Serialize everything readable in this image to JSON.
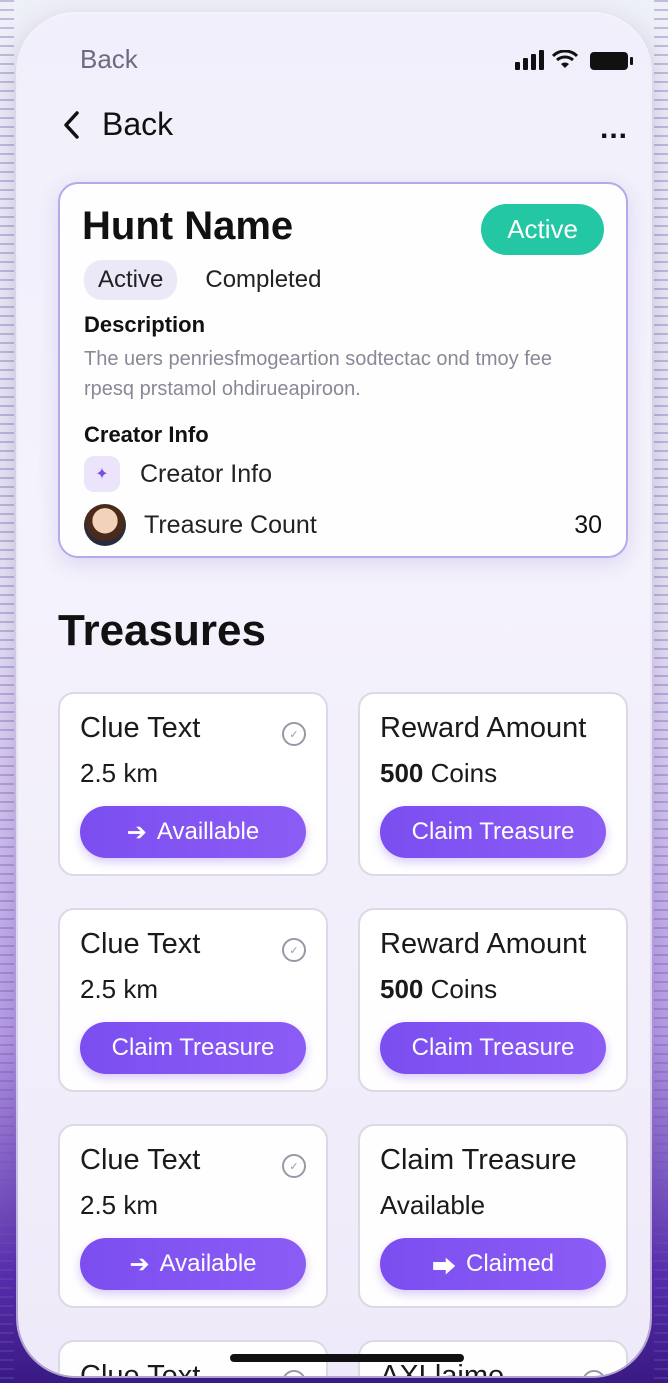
{
  "status_bar": {
    "back_label": "Back"
  },
  "nav": {
    "back_label": "Back",
    "more_label": "..."
  },
  "hunt": {
    "title": "Hunt Name",
    "status": "Active",
    "filters": [
      "Active",
      "Completed"
    ],
    "description_label": "Description",
    "description_text": "The uers penriesfmogeartion sodtectac ond tmoy fee rpesq prstamol ohdirueapiroon.",
    "creator_label": "Creator Info",
    "creator_name": "Creator Info",
    "treasure_label": "Treasure Count",
    "treasure_count": "30"
  },
  "section": {
    "title": "Treasures"
  },
  "treasures": [
    {
      "line1": "Clue Text",
      "line2": "2.5 km",
      "button": "Availlable",
      "icon": "arrow-right-icon",
      "check": true
    },
    {
      "line1": "Reward Amount",
      "line2_bold": "500",
      "line2": "Coins",
      "button": "Claim Treasure"
    },
    {
      "line1": "Clue Text",
      "line2": "2.5 km",
      "button": "Claim Treasure",
      "check": true
    },
    {
      "line1": "Reward Amount",
      "line2_bold": "500",
      "line2": "Coins",
      "button": "Claim Treasure"
    },
    {
      "line1": "Clue Text",
      "line2": "2.5 km",
      "button": "Available",
      "icon": "arrow-right-icon",
      "check": true
    },
    {
      "line1": "Claim Treasure",
      "line2": "Available",
      "button": "Claimed",
      "icon": "claimed-icon"
    },
    {
      "line1": "Clue Text",
      "check": true
    },
    {
      "line1": "AXLlaime",
      "check": true
    }
  ],
  "colors": {
    "accent": "#7b4ef0",
    "active_badge": "#23c7a4"
  }
}
